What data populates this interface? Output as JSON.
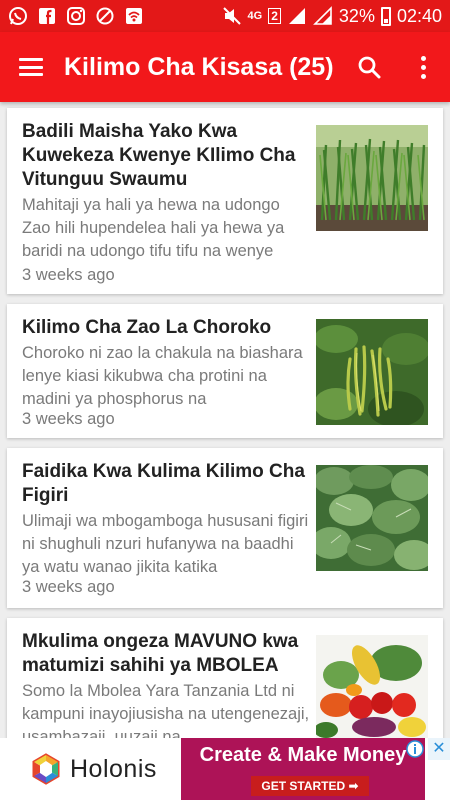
{
  "status_bar": {
    "network": "4G",
    "sim": "2",
    "battery": "32%",
    "time": "02:40"
  },
  "app_bar": {
    "title": "Kilimo Cha Kisasa (25)"
  },
  "articles": [
    {
      "title": "Badili Maisha Yako Kwa Kuwekeza Kwenye KIlimo Cha Vitunguu Swaumu",
      "excerpt": "Mahitaji ya hali ya hewa na udongo Zao hili hupendelea hali ya hewa ya baridi na udongo tifu tifu na wenye",
      "time": "3 weeks ago",
      "thumbnail": "garlic-field-image"
    },
    {
      "title": "Kilimo Cha Zao La Choroko",
      "excerpt": "Choroko ni zao la chakula na biashara lenye kiasi kikubwa cha protini na madini ya phosphorus na",
      "time": "3 weeks ago",
      "thumbnail": "mung-bean-pods-image"
    },
    {
      "title": "Faidika Kwa Kulima Kilimo Cha Figiri",
      "excerpt": "Ulimaji wa mbogamboga hususani figiri  ni shughuli nzuri  hufanywa na baadhi ya watu wanao jikita katika",
      "time": "3 weeks ago",
      "thumbnail": "leafy-greens-image"
    },
    {
      "title": "Mkulima ongeza MAVUNO kwa matumizi sahihi ya MBOLEA",
      "excerpt": "Somo la Mbolea Yara Tanzania Ltd ni kampuni inayojiusisha na utengenezaji, usambazaji, uuzaji na",
      "time": "",
      "thumbnail": "vegetables-image"
    }
  ],
  "ad": {
    "brand": "Holonis",
    "headline": "Create & Make Money",
    "cta": "GET STARTED ➡",
    "close": "✕"
  },
  "colors": {
    "status_bar": "#e31818",
    "app_bar": "#f2181b",
    "ad_banner": "#ad1357"
  }
}
